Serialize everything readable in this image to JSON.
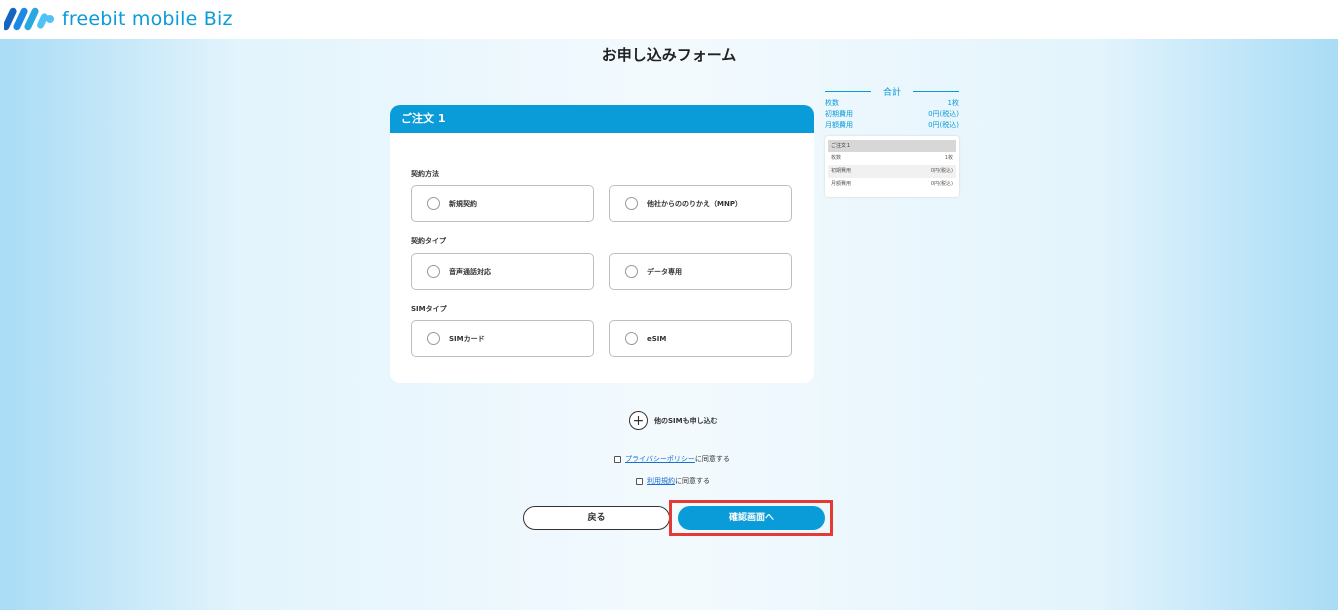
{
  "header": {
    "brand": "freebit mobile Biz",
    "accent": "#0a9bd9"
  },
  "page": {
    "title": "お申し込みフォーム"
  },
  "summary": {
    "title": "合計",
    "rows": [
      {
        "label": "枚数",
        "value": "1枚"
      },
      {
        "label": "初期費用",
        "value": "0円(税込)"
      },
      {
        "label": "月額費用",
        "value": "0円(税込)"
      }
    ],
    "box": {
      "header": "ご注文１",
      "rows": [
        {
          "label": "枚数",
          "value": "1枚"
        },
        {
          "label": "初期費用",
          "value": "0円(税込)"
        },
        {
          "label": "月額費用",
          "value": "0円(税込)"
        }
      ]
    }
  },
  "order": {
    "title": "ご注文 1",
    "sections": [
      {
        "label": "契約方法",
        "options": [
          "新規契約",
          "他社からののりかえ（MNP）"
        ]
      },
      {
        "label": "契約タイプ",
        "options": [
          "音声通話対応",
          "データ専用"
        ]
      },
      {
        "label": "SIMタイプ",
        "options": [
          "SIMカード",
          "eSIM"
        ]
      }
    ]
  },
  "add_more": {
    "label": "他のSIMも申し込む",
    "icon": "plus-circle-icon"
  },
  "agreements": {
    "privacy_link": "プライバシーポリシー",
    "privacy_suffix": "に同意する",
    "terms_link": "利用規約",
    "terms_suffix": "に同意する"
  },
  "buttons": {
    "back": "戻る",
    "confirm": "確認画面へ"
  },
  "colors": {
    "highlight": "#e53935",
    "primary": "#0a9bd9"
  }
}
